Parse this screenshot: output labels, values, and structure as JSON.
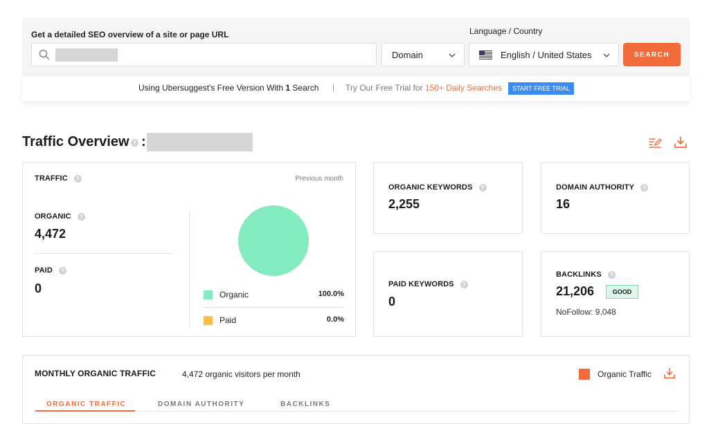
{
  "search": {
    "label": "Get a detailed SEO overview of a site or page URL",
    "language_label": "Language / Country",
    "input_value": "",
    "mode_value": "Domain",
    "language_value": "English / United States",
    "search_label": "SEARCH"
  },
  "promo": {
    "left_prefix": "Using Ubersuggest's Free Version With",
    "left_count": "1",
    "left_suffix": "Search",
    "separator": "|",
    "right_prefix": "Try Our Free Trial for",
    "right_highlight": "150+ Daily Searches",
    "trial_button": "START FREE TRIAL"
  },
  "overview": {
    "title": "Traffic Overview",
    "colon": ":",
    "help": "?"
  },
  "traffic": {
    "label": "TRAFFIC",
    "period": "Previous month",
    "organic_label": "ORGANIC",
    "organic_value": "4,472",
    "paid_label": "PAID",
    "paid_value": "0",
    "legend": [
      {
        "name": "Organic",
        "percent": "100.0%",
        "color": "#84ebc0"
      },
      {
        "name": "Paid",
        "percent": "0.0%",
        "color": "#f9bf4a"
      }
    ]
  },
  "organic_keywords": {
    "label": "ORGANIC KEYWORDS",
    "value": "2,255"
  },
  "domain_authority": {
    "label": "DOMAIN AUTHORITY",
    "value": "16"
  },
  "paid_keywords": {
    "label": "PAID KEYWORDS",
    "value": "0"
  },
  "backlinks": {
    "label": "BACKLINKS",
    "value": "21,206",
    "badge": "GOOD",
    "nofollow": "NoFollow: 9,048"
  },
  "monthly": {
    "title": "MONTHLY ORGANIC TRAFFIC",
    "subtitle": "4,472 organic visitors per month",
    "legend_label": "Organic Traffic",
    "tabs": [
      {
        "label": "ORGANIC TRAFFIC",
        "active": true
      },
      {
        "label": "DOMAIN AUTHORITY",
        "active": false
      },
      {
        "label": "BACKLINKS",
        "active": false
      }
    ]
  },
  "colors": {
    "accent": "#f26b3a",
    "organic": "#84ebc0",
    "paid": "#f9bf4a",
    "trial_blue": "#3c8bf0",
    "good_bg": "#dff7ea"
  }
}
